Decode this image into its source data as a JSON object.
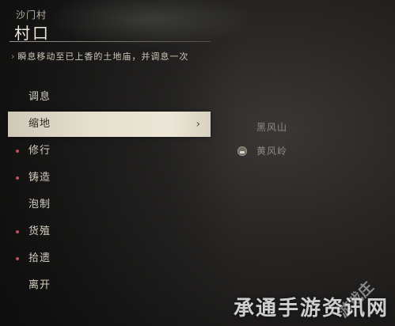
{
  "header": {
    "region": "沙门村",
    "location": "村口",
    "hint": "瞬息移动至已上香的土地庙，并调息一次",
    "hint_arrow": "›"
  },
  "menu": {
    "items": [
      {
        "label": "调息",
        "dot": false
      },
      {
        "label": "缩地",
        "dot": false,
        "selected": true,
        "chevron": "›"
      },
      {
        "label": "修行",
        "dot": true
      },
      {
        "label": "铸造",
        "dot": true
      },
      {
        "label": "泡制",
        "dot": false
      },
      {
        "label": "货殖",
        "dot": true
      },
      {
        "label": "拾遗",
        "dot": true
      },
      {
        "label": "离开",
        "dot": false
      }
    ]
  },
  "submenu": {
    "items": [
      {
        "label": "黑风山",
        "icon": null
      },
      {
        "label": "黄风岭",
        "icon": "shrine-icon"
      }
    ]
  },
  "watermark": {
    "text": "承通手游资讯网",
    "small": "游戏庄"
  },
  "colors": {
    "dot": "#b8535a",
    "selected_bg": "#e6dfcf"
  }
}
